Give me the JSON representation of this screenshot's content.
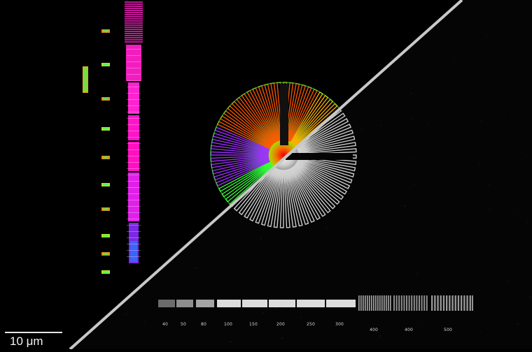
{
  "image": {
    "scalebar_label": "10 μm",
    "bottom_labels": [
      "40",
      "50",
      "80",
      "100",
      "150",
      "200",
      "250",
      "300",
      "400",
      "400",
      "500"
    ],
    "colors": {
      "background": "#000000",
      "divider": "#c8c8c8",
      "grayscale": "#e8e8e8",
      "magenta": "#ff1fc8",
      "violet": "#8a2bff",
      "orange": "#ff6a00",
      "green": "#48ff35"
    }
  }
}
